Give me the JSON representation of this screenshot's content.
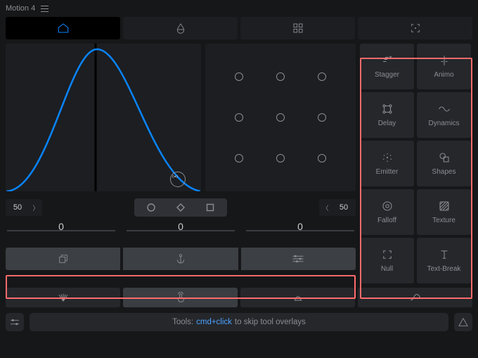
{
  "app": {
    "title": "Motion 4"
  },
  "colors": {
    "accent": "#0a84ff",
    "highlight": "#ff6b6b"
  },
  "topTabs": [
    {
      "name": "home",
      "icon": "home-icon",
      "active": true
    },
    {
      "name": "opacity",
      "icon": "drop-icon",
      "active": false
    },
    {
      "name": "grid",
      "icon": "grid-icon",
      "active": false
    },
    {
      "name": "focus",
      "icon": "focus-icon",
      "active": false
    }
  ],
  "curve": {
    "broadcast": true
  },
  "leftNumber": {
    "value": "50",
    "chevron": "right"
  },
  "rightNumber": {
    "value": "50",
    "chevron": "left"
  },
  "shapePicker": {
    "options": [
      "circle",
      "diamond",
      "square"
    ]
  },
  "sliders": [
    {
      "label": "0"
    },
    {
      "label": "0"
    },
    {
      "label": "0"
    }
  ],
  "greyButtons": [
    {
      "name": "layers",
      "icon": "layers-icon"
    },
    {
      "name": "anchor",
      "icon": "anchor-icon"
    },
    {
      "name": "options",
      "icon": "sliders-icon"
    }
  ],
  "tools": [
    {
      "label": "Stagger",
      "icon": "stagger-icon"
    },
    {
      "label": "Animo",
      "icon": "animo-icon"
    },
    {
      "label": "Delay",
      "icon": "delay-icon"
    },
    {
      "label": "Dynamics",
      "icon": "dynamics-icon"
    },
    {
      "label": "Emitter",
      "icon": "emitter-icon"
    },
    {
      "label": "Shapes",
      "icon": "shapes-icon"
    },
    {
      "label": "Falloff",
      "icon": "falloff-icon"
    },
    {
      "label": "Texture",
      "icon": "texture-icon"
    },
    {
      "label": "Null",
      "icon": "null-icon"
    },
    {
      "label": "Text-Break",
      "icon": "textbreak-icon"
    }
  ],
  "bottomTabs": [
    {
      "name": "ease",
      "icon": "fan-icon",
      "active": false
    },
    {
      "name": "finger",
      "icon": "tap-icon",
      "active": true
    },
    {
      "name": "bell",
      "icon": "bell-icon",
      "active": false
    },
    {
      "name": "curve",
      "icon": "curve-icon",
      "active": false
    }
  ],
  "footer": {
    "leftIcon": "settings-sliders-icon",
    "rightIcon": "warning-icon",
    "hintPrefix": "Tools:",
    "hintKbd": "cmd+click",
    "hintSuffix": "to skip tool overlays"
  }
}
